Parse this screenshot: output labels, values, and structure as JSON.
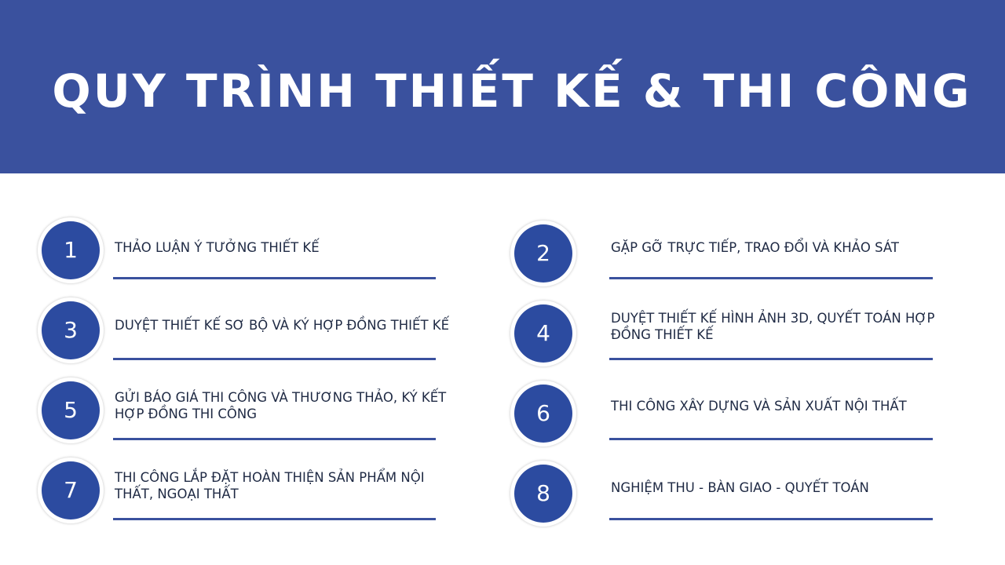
{
  "title": "QUY TRÌNH THIẾT KẾ & THI CÔNG",
  "steps": [
    {
      "number": "1",
      "label": "THẢO LUẬN Ý TƯỞNG THIẾT KẾ"
    },
    {
      "number": "2",
      "label": "GẶP GỠ TRỰC TIẾP, TRAO ĐỔI VÀ KHẢO SÁT"
    },
    {
      "number": "3",
      "label": "DUYỆT THIẾT KẾ SƠ BỘ VÀ KÝ HỢP ĐỒNG THIẾT KẾ"
    },
    {
      "number": "4",
      "label": "DUYỆT THIẾT KẾ HÌNH ẢNH 3D, QUYẾT TOÁN HỢP ĐỒNG THIẾT KẾ"
    },
    {
      "number": "5",
      "label": "GỬI BÁO GIÁ THI CÔNG VÀ THƯƠNG THẢO, KÝ KẾT HỢP ĐỒNG THI CÔNG"
    },
    {
      "number": "6",
      "label": "THI CÔNG XÂY DỰNG VÀ SẢN XUẤT NỘI THẤT"
    },
    {
      "number": "7",
      "label": "THI CÔNG LẮP ĐẶT HOÀN THIỆN SẢN PHẨM NỘI THẤT, NGOẠI THẤT"
    },
    {
      "number": "8",
      "label": "NGHIỆM THU - BÀN GIAO - QUYẾT TOÁN"
    }
  ],
  "colors": {
    "header": "#3a519e",
    "circle": "#2c4ba0",
    "text": "#1f2a44"
  }
}
